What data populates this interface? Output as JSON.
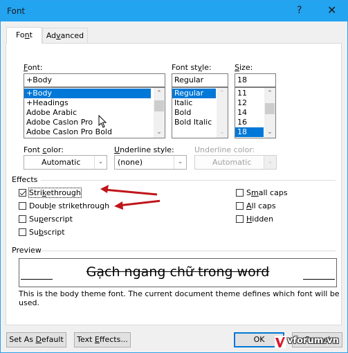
{
  "window": {
    "title": "Font",
    "help_label": "?",
    "close_label": "✕"
  },
  "tabs": [
    {
      "label_pre": "Fo",
      "label_u": "n",
      "label_post": "t",
      "active": true
    },
    {
      "label_pre": "Ad",
      "label_u": "v",
      "label_post": "anced",
      "active": false
    }
  ],
  "font": {
    "label_u": "F",
    "label_post": "ont:",
    "value": "+Body",
    "items": [
      "+Body",
      "+Headings",
      "Adobe Arabic",
      "Adobe Caslon Pro",
      "Adobe Caslon Pro Bold"
    ],
    "selected": "+Body"
  },
  "font_style": {
    "label_pre": "Font st",
    "label_u": "y",
    "label_post": "le:",
    "value": "Regular",
    "items": [
      "Regular",
      "Italic",
      "Bold",
      "Bold Italic"
    ],
    "selected": "Regular"
  },
  "size": {
    "label_u": "S",
    "label_post": "ize:",
    "value": "18",
    "items": [
      "11",
      "12",
      "14",
      "16",
      "18"
    ],
    "selected": "18"
  },
  "font_color": {
    "label_pre": "Font ",
    "label_u": "c",
    "label_post": "olor:",
    "value": "Automatic"
  },
  "underline_style": {
    "label_u": "U",
    "label_post": "nderline style:",
    "value": "(none)"
  },
  "underline_color": {
    "label": "Underline color:",
    "value": "Automatic",
    "disabled": true
  },
  "effects": {
    "title": "Effects",
    "left": [
      {
        "pre": "Stri",
        "u": "k",
        "post": "ethrough",
        "checked": true
      },
      {
        "pre": "Doub",
        "u": "l",
        "post": "e strikethrough",
        "checked": false
      },
      {
        "pre": "Su",
        "u": "p",
        "post": "erscript",
        "checked": false
      },
      {
        "pre": "Su",
        "u": "b",
        "post": "script",
        "checked": false
      }
    ],
    "right": [
      {
        "pre": "S",
        "u": "m",
        "post": "all caps",
        "checked": false
      },
      {
        "pre": "",
        "u": "A",
        "post": "ll caps",
        "checked": false
      },
      {
        "pre": "",
        "u": "H",
        "post": "idden",
        "checked": false
      }
    ]
  },
  "preview": {
    "title": "Preview",
    "sample": "Gạch ngang chữ trong word",
    "note": "This is the body theme font. The current document theme defines which font will be used."
  },
  "buttons": {
    "set_default_pre": "Set As ",
    "set_default_u": "D",
    "set_default_post": "efault",
    "text_effects_pre": "Text ",
    "text_effects_u": "E",
    "text_effects_post": "ffects...",
    "ok": "OK",
    "cancel": "Cancel"
  },
  "annotation": {
    "arrow_color": "#c0151a"
  },
  "watermark": "vforum.vn"
}
